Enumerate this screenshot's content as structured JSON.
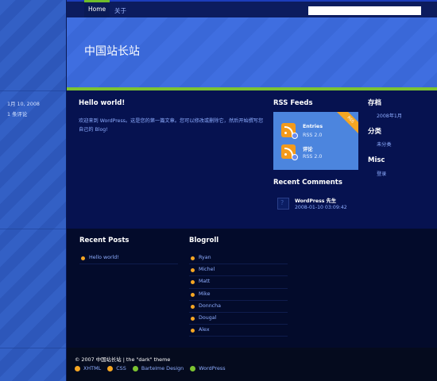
{
  "nav": {
    "home": "Home",
    "about": "关于"
  },
  "search": {
    "placeholder": ""
  },
  "site": {
    "title": "中国站长站"
  },
  "sidebar": {
    "date": "1月 10, 2008",
    "comments": "1 条评论"
  },
  "post": {
    "title": "Hello world!",
    "body": "欢迎来到 WordPress。这是您的第一篇文章。您可以修改或删除它，然后开始撰写您自己的 Blog!"
  },
  "rss": {
    "heading": "RSS Feeds",
    "ribbon": "RSS",
    "items": [
      {
        "label": "Entries",
        "sub": "RSS 2.0",
        "icon": "rss-icon"
      },
      {
        "label": "评论",
        "sub": "RSS 2.0",
        "icon": "rss-icon"
      }
    ]
  },
  "recent_comments": {
    "heading": "Recent Comments",
    "author": "WordPress 先生",
    "date": "2008-01-10 03:09:42"
  },
  "archive": {
    "heading": "存档",
    "item": "2008年1月"
  },
  "categories": {
    "heading": "分类",
    "item": "未分类"
  },
  "misc": {
    "heading": "Misc",
    "item": "登录"
  },
  "recent_posts": {
    "heading": "Recent Posts",
    "items": [
      "Hello world!"
    ]
  },
  "blogroll": {
    "heading": "Blogroll",
    "items": [
      "Ryan",
      "Michel",
      "Matt",
      "Mike",
      "Donncha",
      "Dougal",
      "Alex"
    ]
  },
  "footer": {
    "copyright": "© 2007 中国站长站 | the \"dark\" theme",
    "links": [
      "XHTML",
      "CSS",
      "Bartelme Design",
      "WordPress"
    ]
  },
  "colors": {
    "accent_green": "#7cc331",
    "bullet_orange": "#f5a623",
    "link_blue": "#8eadff"
  }
}
